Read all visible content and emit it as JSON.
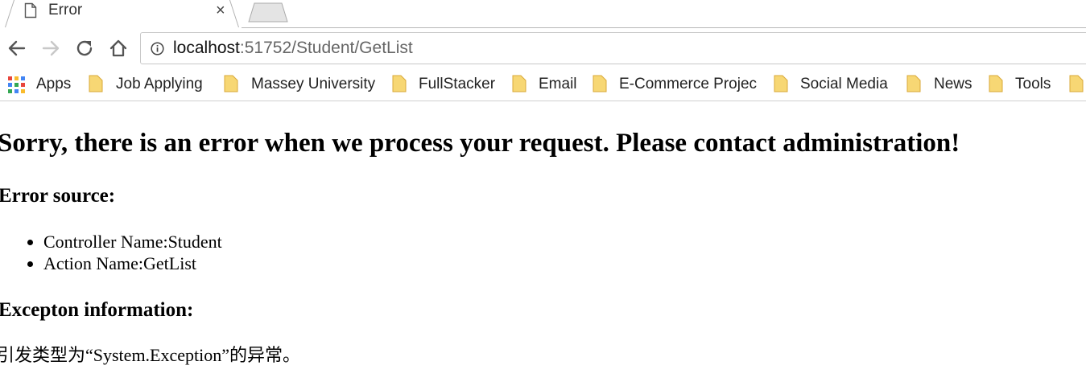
{
  "browser": {
    "tab": {
      "title": "Error",
      "close_glyph": "×"
    },
    "toolbar": {
      "back_icon": "back-arrow-icon",
      "forward_icon": "forward-arrow-icon",
      "reload_icon": "reload-icon",
      "home_icon": "home-icon",
      "url_host": "localhost",
      "url_rest": ":51752/Student/GetList"
    },
    "bookmarks": [
      {
        "label": "Apps",
        "icon": "apps-grid-icon"
      },
      {
        "label": "Job Applying",
        "icon": "folder-icon"
      },
      {
        "label": "Massey University",
        "icon": "folder-icon"
      },
      {
        "label": "FullStacker",
        "icon": "folder-icon"
      },
      {
        "label": "Email",
        "icon": "folder-icon"
      },
      {
        "label": "E-Commerce Projec",
        "icon": "folder-icon"
      },
      {
        "label": "Social Media",
        "icon": "folder-icon"
      },
      {
        "label": "News",
        "icon": "folder-icon"
      },
      {
        "label": "Tools",
        "icon": "folder-icon"
      }
    ],
    "colors": {
      "folder_fill": "#f7d774",
      "folder_stroke": "#d9a93a"
    }
  },
  "page": {
    "heading": "Sorry, there is an error when we process your request. Please contact administration!",
    "source_heading": "Error source:",
    "source_items": [
      "Controller Name:Student",
      "Action Name:GetList"
    ],
    "exception_heading": "Excepton information:",
    "exception_message": "引发类型为“System.Exception”的异常。"
  }
}
